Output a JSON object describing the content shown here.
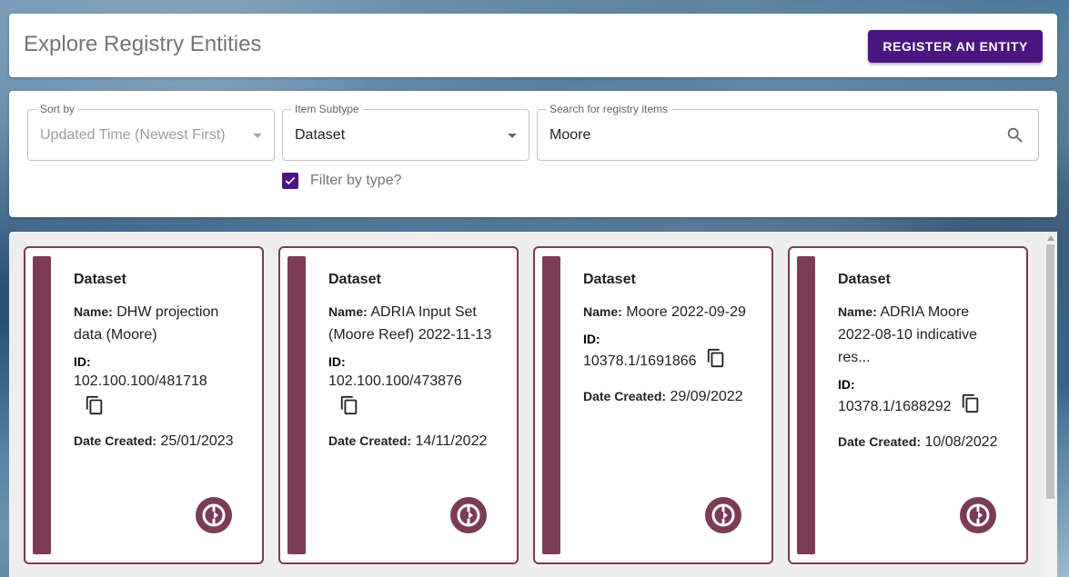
{
  "header": {
    "title": "Explore Registry Entities",
    "register_label": "REGISTER AN ENTITY"
  },
  "filters": {
    "sort_label": "Sort by",
    "sort_value": "Updated Time (Newest First)",
    "subtype_label": "Item Subtype",
    "subtype_value": "Dataset",
    "search_label": "Search for registry items",
    "search_value": "Moore",
    "filter_checkbox_label": "Filter by type?",
    "filter_checked": true
  },
  "cards": [
    {
      "type": "Dataset",
      "name_key": "Name:",
      "name": "DHW projection data (Moore)",
      "id_key": "ID:",
      "id": "102.100.100/481718",
      "date_key": "Date Created:",
      "date": "25/01/2023"
    },
    {
      "type": "Dataset",
      "name_key": "Name:",
      "name": "ADRIA Input Set (Moore Reef) 2022-11-13",
      "id_key": "ID:",
      "id": "102.100.100/473876",
      "date_key": "Date Created:",
      "date": "14/11/2022"
    },
    {
      "type": "Dataset",
      "name_key": "Name:",
      "name": "Moore 2022-09-29",
      "id_key": "ID:",
      "id": "10378.1/1691866",
      "date_key": "Date Created:",
      "date": "29/09/2022"
    },
    {
      "type": "Dataset",
      "name_key": "Name:",
      "name": "ADRIA Moore 2022-08-10 indicative res...",
      "id_key": "ID:",
      "id": "10378.1/1688292",
      "date_key": "Date Created:",
      "date": "10/08/2022"
    }
  ],
  "colors": {
    "primary": "#4a1580",
    "card_accent": "#7b3b57"
  },
  "icons": [
    "search-icon",
    "dropdown-arrow-icon",
    "checkbox-checked-icon",
    "copy-icon",
    "view-entity-icon"
  ]
}
